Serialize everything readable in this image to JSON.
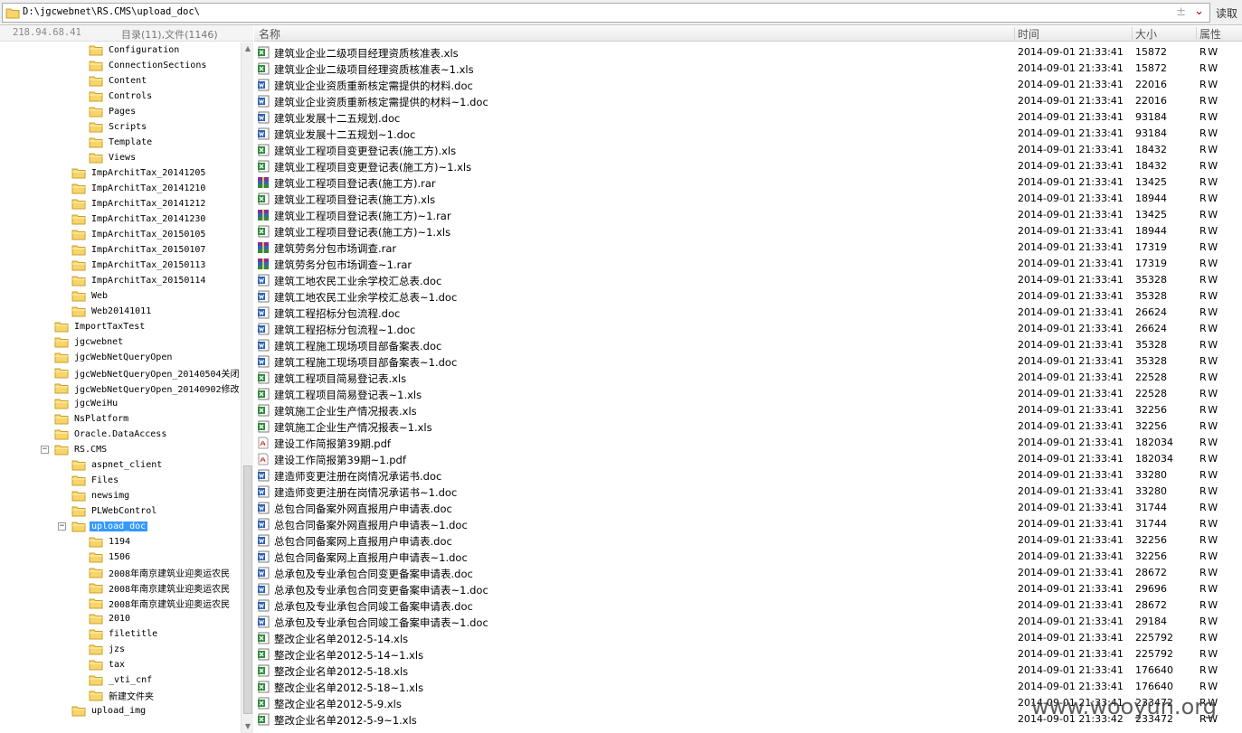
{
  "path_bar": {
    "path": "D:\\jgcwebnet\\RS.CMS\\upload_doc\\",
    "read_label": "读取"
  },
  "info": {
    "ip": "218.94.68.41",
    "counts": "目录(11),文件(1146)"
  },
  "columns": {
    "name": "名称",
    "time": "时间",
    "size": "大小",
    "attr": "属性"
  },
  "tree": [
    {
      "label": "Configuration",
      "level": 5
    },
    {
      "label": "ConnectionSections",
      "level": 5
    },
    {
      "label": "Content",
      "level": 5
    },
    {
      "label": "Controls",
      "level": 5
    },
    {
      "label": "Pages",
      "level": 5
    },
    {
      "label": "Scripts",
      "level": 5
    },
    {
      "label": "Template",
      "level": 5
    },
    {
      "label": "Views",
      "level": 5
    },
    {
      "label": "ImpArchitTax_20141205",
      "level": 4
    },
    {
      "label": "ImpArchitTax_20141210",
      "level": 4
    },
    {
      "label": "ImpArchitTax_20141212",
      "level": 4
    },
    {
      "label": "ImpArchitTax_20141230",
      "level": 4
    },
    {
      "label": "ImpArchitTax_20150105",
      "level": 4
    },
    {
      "label": "ImpArchitTax_20150107",
      "level": 4
    },
    {
      "label": "ImpArchitTax_20150113",
      "level": 4
    },
    {
      "label": "ImpArchitTax_20150114",
      "level": 4
    },
    {
      "label": "Web",
      "level": 4
    },
    {
      "label": "Web20141011",
      "level": 4
    },
    {
      "label": "ImportTaxTest",
      "level": 3
    },
    {
      "label": "jgcwebnet",
      "level": 3
    },
    {
      "label": "jgcWebNetQueryOpen",
      "level": 3
    },
    {
      "label": "jgcWebNetQueryOpen_20140504关闭",
      "level": 3
    },
    {
      "label": "jgcWebNetQueryOpen_20140902修改",
      "level": 3
    },
    {
      "label": "jgcWeiHu",
      "level": 3
    },
    {
      "label": "NsPlatform",
      "level": 3
    },
    {
      "label": "Oracle.DataAccess",
      "level": 3
    },
    {
      "label": "RS.CMS",
      "level": 3,
      "toggle": "−"
    },
    {
      "label": "aspnet_client",
      "level": 4
    },
    {
      "label": "Files",
      "level": 4
    },
    {
      "label": "newsimg",
      "level": 4
    },
    {
      "label": "PLWebControl",
      "level": 4
    },
    {
      "label": "upload_doc",
      "level": 4,
      "toggle": "−",
      "selected": true
    },
    {
      "label": "1194",
      "level": 5
    },
    {
      "label": "1506",
      "level": 5
    },
    {
      "label": "2008年南京建筑业迎奥运农民",
      "level": 5
    },
    {
      "label": "2008年南京建筑业迎奥运农民",
      "level": 5
    },
    {
      "label": "2008年南京建筑业迎奥运农民",
      "level": 5
    },
    {
      "label": "2010",
      "level": 5
    },
    {
      "label": "filetitle",
      "level": 5
    },
    {
      "label": "jzs",
      "level": 5
    },
    {
      "label": "tax",
      "level": 5
    },
    {
      "label": "_vti_cnf",
      "level": 5
    },
    {
      "label": "新建文件夹",
      "level": 5
    },
    {
      "label": "upload_img",
      "level": 4
    }
  ],
  "files": [
    {
      "name": "建筑业企业二级项目经理资质核准表.xls",
      "type": "xls",
      "time": "2014-09-01 21:33:41",
      "size": "15872",
      "attr": "RW"
    },
    {
      "name": "建筑业企业二级项目经理资质核准表~1.xls",
      "type": "xls",
      "time": "2014-09-01 21:33:41",
      "size": "15872",
      "attr": "RW"
    },
    {
      "name": "建筑业企业资质重新核定需提供的材料.doc",
      "type": "doc",
      "time": "2014-09-01 21:33:41",
      "size": "22016",
      "attr": "RW"
    },
    {
      "name": "建筑业企业资质重新核定需提供的材料~1.doc",
      "type": "doc",
      "time": "2014-09-01 21:33:41",
      "size": "22016",
      "attr": "RW"
    },
    {
      "name": "建筑业发展十二五规划.doc",
      "type": "doc",
      "time": "2014-09-01 21:33:41",
      "size": "93184",
      "attr": "RW"
    },
    {
      "name": "建筑业发展十二五规划~1.doc",
      "type": "doc",
      "time": "2014-09-01 21:33:41",
      "size": "93184",
      "attr": "RW"
    },
    {
      "name": "建筑业工程项目变更登记表(施工方).xls",
      "type": "xls",
      "time": "2014-09-01 21:33:41",
      "size": "18432",
      "attr": "RW"
    },
    {
      "name": "建筑业工程项目变更登记表(施工方)~1.xls",
      "type": "xls",
      "time": "2014-09-01 21:33:41",
      "size": "18432",
      "attr": "RW"
    },
    {
      "name": "建筑业工程项目登记表(施工方).rar",
      "type": "rar",
      "time": "2014-09-01 21:33:41",
      "size": "13425",
      "attr": "RW"
    },
    {
      "name": "建筑业工程项目登记表(施工方).xls",
      "type": "xls",
      "time": "2014-09-01 21:33:41",
      "size": "18944",
      "attr": "RW"
    },
    {
      "name": "建筑业工程项目登记表(施工方)~1.rar",
      "type": "rar",
      "time": "2014-09-01 21:33:41",
      "size": "13425",
      "attr": "RW"
    },
    {
      "name": "建筑业工程项目登记表(施工方)~1.xls",
      "type": "xls",
      "time": "2014-09-01 21:33:41",
      "size": "18944",
      "attr": "RW"
    },
    {
      "name": "建筑劳务分包市场调查.rar",
      "type": "rar",
      "time": "2014-09-01 21:33:41",
      "size": "17319",
      "attr": "RW"
    },
    {
      "name": "建筑劳务分包市场调查~1.rar",
      "type": "rar",
      "time": "2014-09-01 21:33:41",
      "size": "17319",
      "attr": "RW"
    },
    {
      "name": "建筑工地农民工业余学校汇总表.doc",
      "type": "doc",
      "time": "2014-09-01 21:33:41",
      "size": "35328",
      "attr": "RW"
    },
    {
      "name": "建筑工地农民工业余学校汇总表~1.doc",
      "type": "doc",
      "time": "2014-09-01 21:33:41",
      "size": "35328",
      "attr": "RW"
    },
    {
      "name": "建筑工程招标分包流程.doc",
      "type": "doc",
      "time": "2014-09-01 21:33:41",
      "size": "26624",
      "attr": "RW"
    },
    {
      "name": "建筑工程招标分包流程~1.doc",
      "type": "doc",
      "time": "2014-09-01 21:33:41",
      "size": "26624",
      "attr": "RW"
    },
    {
      "name": "建筑工程施工现场项目部备案表.doc",
      "type": "doc",
      "time": "2014-09-01 21:33:41",
      "size": "35328",
      "attr": "RW"
    },
    {
      "name": "建筑工程施工现场项目部备案表~1.doc",
      "type": "doc",
      "time": "2014-09-01 21:33:41",
      "size": "35328",
      "attr": "RW"
    },
    {
      "name": "建筑工程项目简易登记表.xls",
      "type": "xls",
      "time": "2014-09-01 21:33:41",
      "size": "22528",
      "attr": "RW"
    },
    {
      "name": "建筑工程项目简易登记表~1.xls",
      "type": "xls",
      "time": "2014-09-01 21:33:41",
      "size": "22528",
      "attr": "RW"
    },
    {
      "name": "建筑施工企业生产情况报表.xls",
      "type": "xls",
      "time": "2014-09-01 21:33:41",
      "size": "32256",
      "attr": "RW"
    },
    {
      "name": "建筑施工企业生产情况报表~1.xls",
      "type": "xls",
      "time": "2014-09-01 21:33:41",
      "size": "32256",
      "attr": "RW"
    },
    {
      "name": "建设工作简报第39期.pdf",
      "type": "pdf",
      "time": "2014-09-01 21:33:41",
      "size": "182034",
      "attr": "RW"
    },
    {
      "name": "建设工作简报第39期~1.pdf",
      "type": "pdf",
      "time": "2014-09-01 21:33:41",
      "size": "182034",
      "attr": "RW"
    },
    {
      "name": "建造师变更注册在岗情况承诺书.doc",
      "type": "doc",
      "time": "2014-09-01 21:33:41",
      "size": "33280",
      "attr": "RW"
    },
    {
      "name": "建造师变更注册在岗情况承诺书~1.doc",
      "type": "doc",
      "time": "2014-09-01 21:33:41",
      "size": "33280",
      "attr": "RW"
    },
    {
      "name": "总包合同备案外网直报用户申请表.doc",
      "type": "doc",
      "time": "2014-09-01 21:33:41",
      "size": "31744",
      "attr": "RW"
    },
    {
      "name": "总包合同备案外网直报用户申请表~1.doc",
      "type": "doc",
      "time": "2014-09-01 21:33:41",
      "size": "31744",
      "attr": "RW"
    },
    {
      "name": "总包合同备案网上直报用户申请表.doc",
      "type": "doc",
      "time": "2014-09-01 21:33:41",
      "size": "32256",
      "attr": "RW"
    },
    {
      "name": "总包合同备案网上直报用户申请表~1.doc",
      "type": "doc",
      "time": "2014-09-01 21:33:41",
      "size": "32256",
      "attr": "RW"
    },
    {
      "name": "总承包及专业承包合同变更备案申请表.doc",
      "type": "doc",
      "time": "2014-09-01 21:33:41",
      "size": "28672",
      "attr": "RW"
    },
    {
      "name": "总承包及专业承包合同变更备案申请表~1.doc",
      "type": "doc",
      "time": "2014-09-01 21:33:41",
      "size": "29696",
      "attr": "RW"
    },
    {
      "name": "总承包及专业承包合同竣工备案申请表.doc",
      "type": "doc",
      "time": "2014-09-01 21:33:41",
      "size": "28672",
      "attr": "RW"
    },
    {
      "name": "总承包及专业承包合同竣工备案申请表~1.doc",
      "type": "doc",
      "time": "2014-09-01 21:33:41",
      "size": "29184",
      "attr": "RW"
    },
    {
      "name": "整改企业名单2012-5-14.xls",
      "type": "xls",
      "time": "2014-09-01 21:33:41",
      "size": "225792",
      "attr": "RW"
    },
    {
      "name": "整改企业名单2012-5-14~1.xls",
      "type": "xls",
      "time": "2014-09-01 21:33:41",
      "size": "225792",
      "attr": "RW"
    },
    {
      "name": "整改企业名单2012-5-18.xls",
      "type": "xls",
      "time": "2014-09-01 21:33:41",
      "size": "176640",
      "attr": "RW"
    },
    {
      "name": "整改企业名单2012-5-18~1.xls",
      "type": "xls",
      "time": "2014-09-01 21:33:41",
      "size": "176640",
      "attr": "RW"
    },
    {
      "name": "整改企业名单2012-5-9.xls",
      "type": "xls",
      "time": "2014-09-01 21:33:41",
      "size": "233472",
      "attr": "RW"
    },
    {
      "name": "整改企业名单2012-5-9~1.xls",
      "type": "xls",
      "time": "2014-09-01 21:33:42",
      "size": "233472",
      "attr": "RW"
    }
  ],
  "watermark": "www.wooyun.org",
  "colors": {
    "selection": "#3399ff",
    "folder": "#f7d56b",
    "folder_edge": "#c9a02a",
    "xls": "#2e8b3a",
    "doc": "#2b5fb4",
    "pdf": "#d8302b"
  }
}
